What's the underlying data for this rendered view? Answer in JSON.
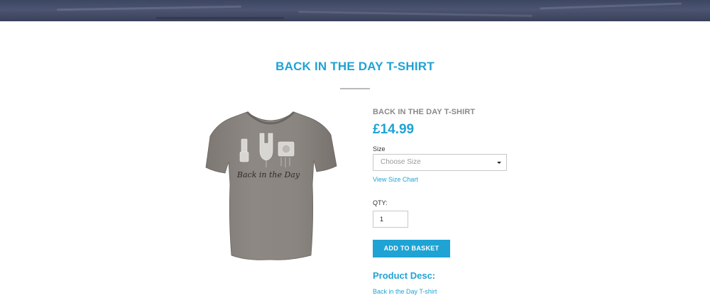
{
  "product": {
    "page_title": "BACK IN THE DAY T-SHIRT",
    "name": "BACK IN THE DAY T-SHIRT",
    "price": "£14.99",
    "image_print_text": "Back in the Day"
  },
  "size": {
    "label": "Size",
    "selected": "Choose Size",
    "size_chart_link": "View Size Chart"
  },
  "quantity": {
    "label": "QTY:",
    "value": "1"
  },
  "actions": {
    "add_to_basket": "ADD TO BASKET"
  },
  "description": {
    "heading": "Product Desc:",
    "text": "Back in the Day T-shirt"
  },
  "colors": {
    "accent": "#1fa3d4",
    "shirt": "#8a8580",
    "banner": "#454d68"
  }
}
